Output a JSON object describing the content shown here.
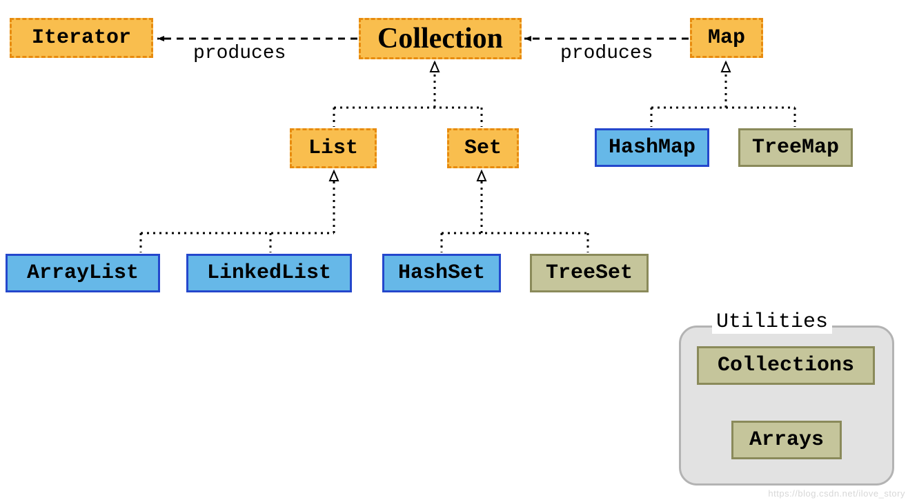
{
  "nodes": {
    "iterator": {
      "label": "Iterator"
    },
    "collection": {
      "label": "Collection"
    },
    "map": {
      "label": "Map"
    },
    "list": {
      "label": "List"
    },
    "set": {
      "label": "Set"
    },
    "hashmap": {
      "label": "HashMap"
    },
    "treemap": {
      "label": "TreeMap"
    },
    "arraylist": {
      "label": "ArrayList"
    },
    "linkedlist": {
      "label": "LinkedList"
    },
    "hashset": {
      "label": "HashSet"
    },
    "treeset": {
      "label": "TreeSet"
    },
    "collections": {
      "label": "Collections"
    },
    "arrays": {
      "label": "Arrays"
    }
  },
  "edges": {
    "produces_left": {
      "label": "produces"
    },
    "produces_right": {
      "label": "produces"
    }
  },
  "groups": {
    "utilities": {
      "title": "Utilities"
    }
  },
  "colors": {
    "interface_fill": "#f9be4e",
    "interface_border": "#e78b0f",
    "class_primary_fill": "#66b8e8",
    "class_primary_border": "#2447cc",
    "class_secondary_fill": "#c5c59b",
    "class_secondary_border": "#8a8a5a",
    "group_fill": "#e2e2e2",
    "group_border": "#b3b3b3"
  },
  "watermark": "https://blog.csdn.net/ilove_story"
}
